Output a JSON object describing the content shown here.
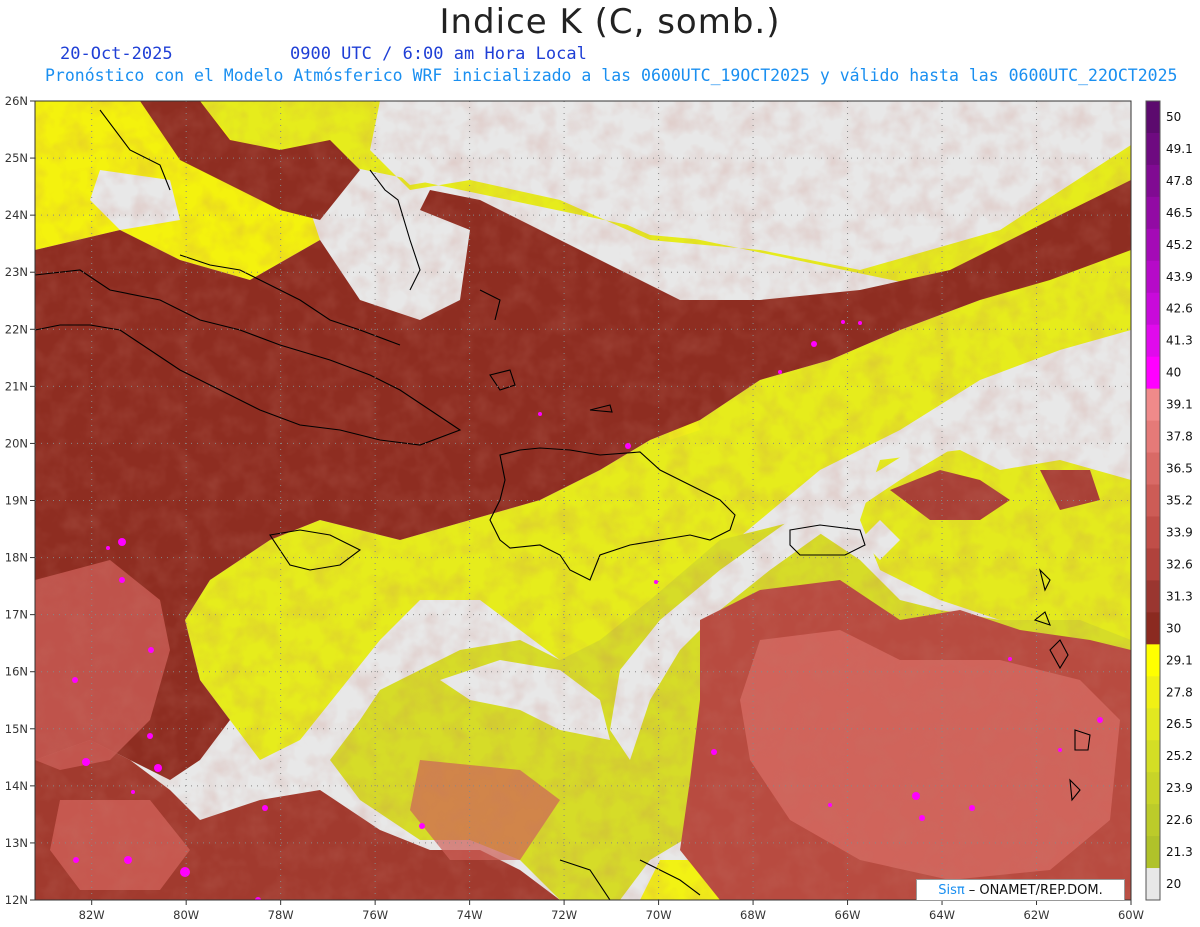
{
  "header": {
    "title": "Indice K (C, somb.)",
    "date": "20-Oct-2025",
    "time": "0900 UTC / 6:00 am Hora Local",
    "description": "Pronóstico con el Modelo Atmósferico WRF inicializado a las 0600UTC_19OCT2025 y válido hasta las  0600UTC_22OCT2025"
  },
  "map": {
    "lon_range": [
      -83.2,
      -60
    ],
    "lat_range": [
      12,
      26
    ],
    "lon_ticks": [
      "82W",
      "80W",
      "78W",
      "76W",
      "74W",
      "72W",
      "70W",
      "68W",
      "66W",
      "64W",
      "62W",
      "60W"
    ],
    "lat_ticks": [
      "12N",
      "13N",
      "14N",
      "15N",
      "16N",
      "17N",
      "18N",
      "19N",
      "20N",
      "21N",
      "22N",
      "23N",
      "24N",
      "25N",
      "26N"
    ],
    "field": "Indice K"
  },
  "colorbar": {
    "levels": [
      "50",
      "49.1",
      "47.8",
      "46.5",
      "45.2",
      "43.9",
      "42.6",
      "41.3",
      "40",
      "39.1",
      "37.8",
      "36.5",
      "35.2",
      "33.9",
      "32.6",
      "31.3",
      "30",
      "29.1",
      "27.8",
      "26.5",
      "25.2",
      "23.9",
      "22.6",
      "21.3",
      "20"
    ],
    "colors": [
      "#5c0a6e",
      "#6e0a80",
      "#800a92",
      "#920aa4",
      "#a40ab6",
      "#b60ac8",
      "#c80ada",
      "#e00aec",
      "#ff00ff",
      "#f08a8a",
      "#e57a78",
      "#d96a66",
      "#cd5c56",
      "#c04e48",
      "#b0423c",
      "#9a3630",
      "#8b2a20",
      "#ffff00",
      "#f0f015",
      "#e2e820",
      "#d4de25",
      "#c8d428",
      "#bccb2a",
      "#b0c22a",
      "#e8e8e8"
    ]
  },
  "credit": {
    "brand": "Sisπ",
    "text": "– ONAMET/REP.DOM."
  }
}
